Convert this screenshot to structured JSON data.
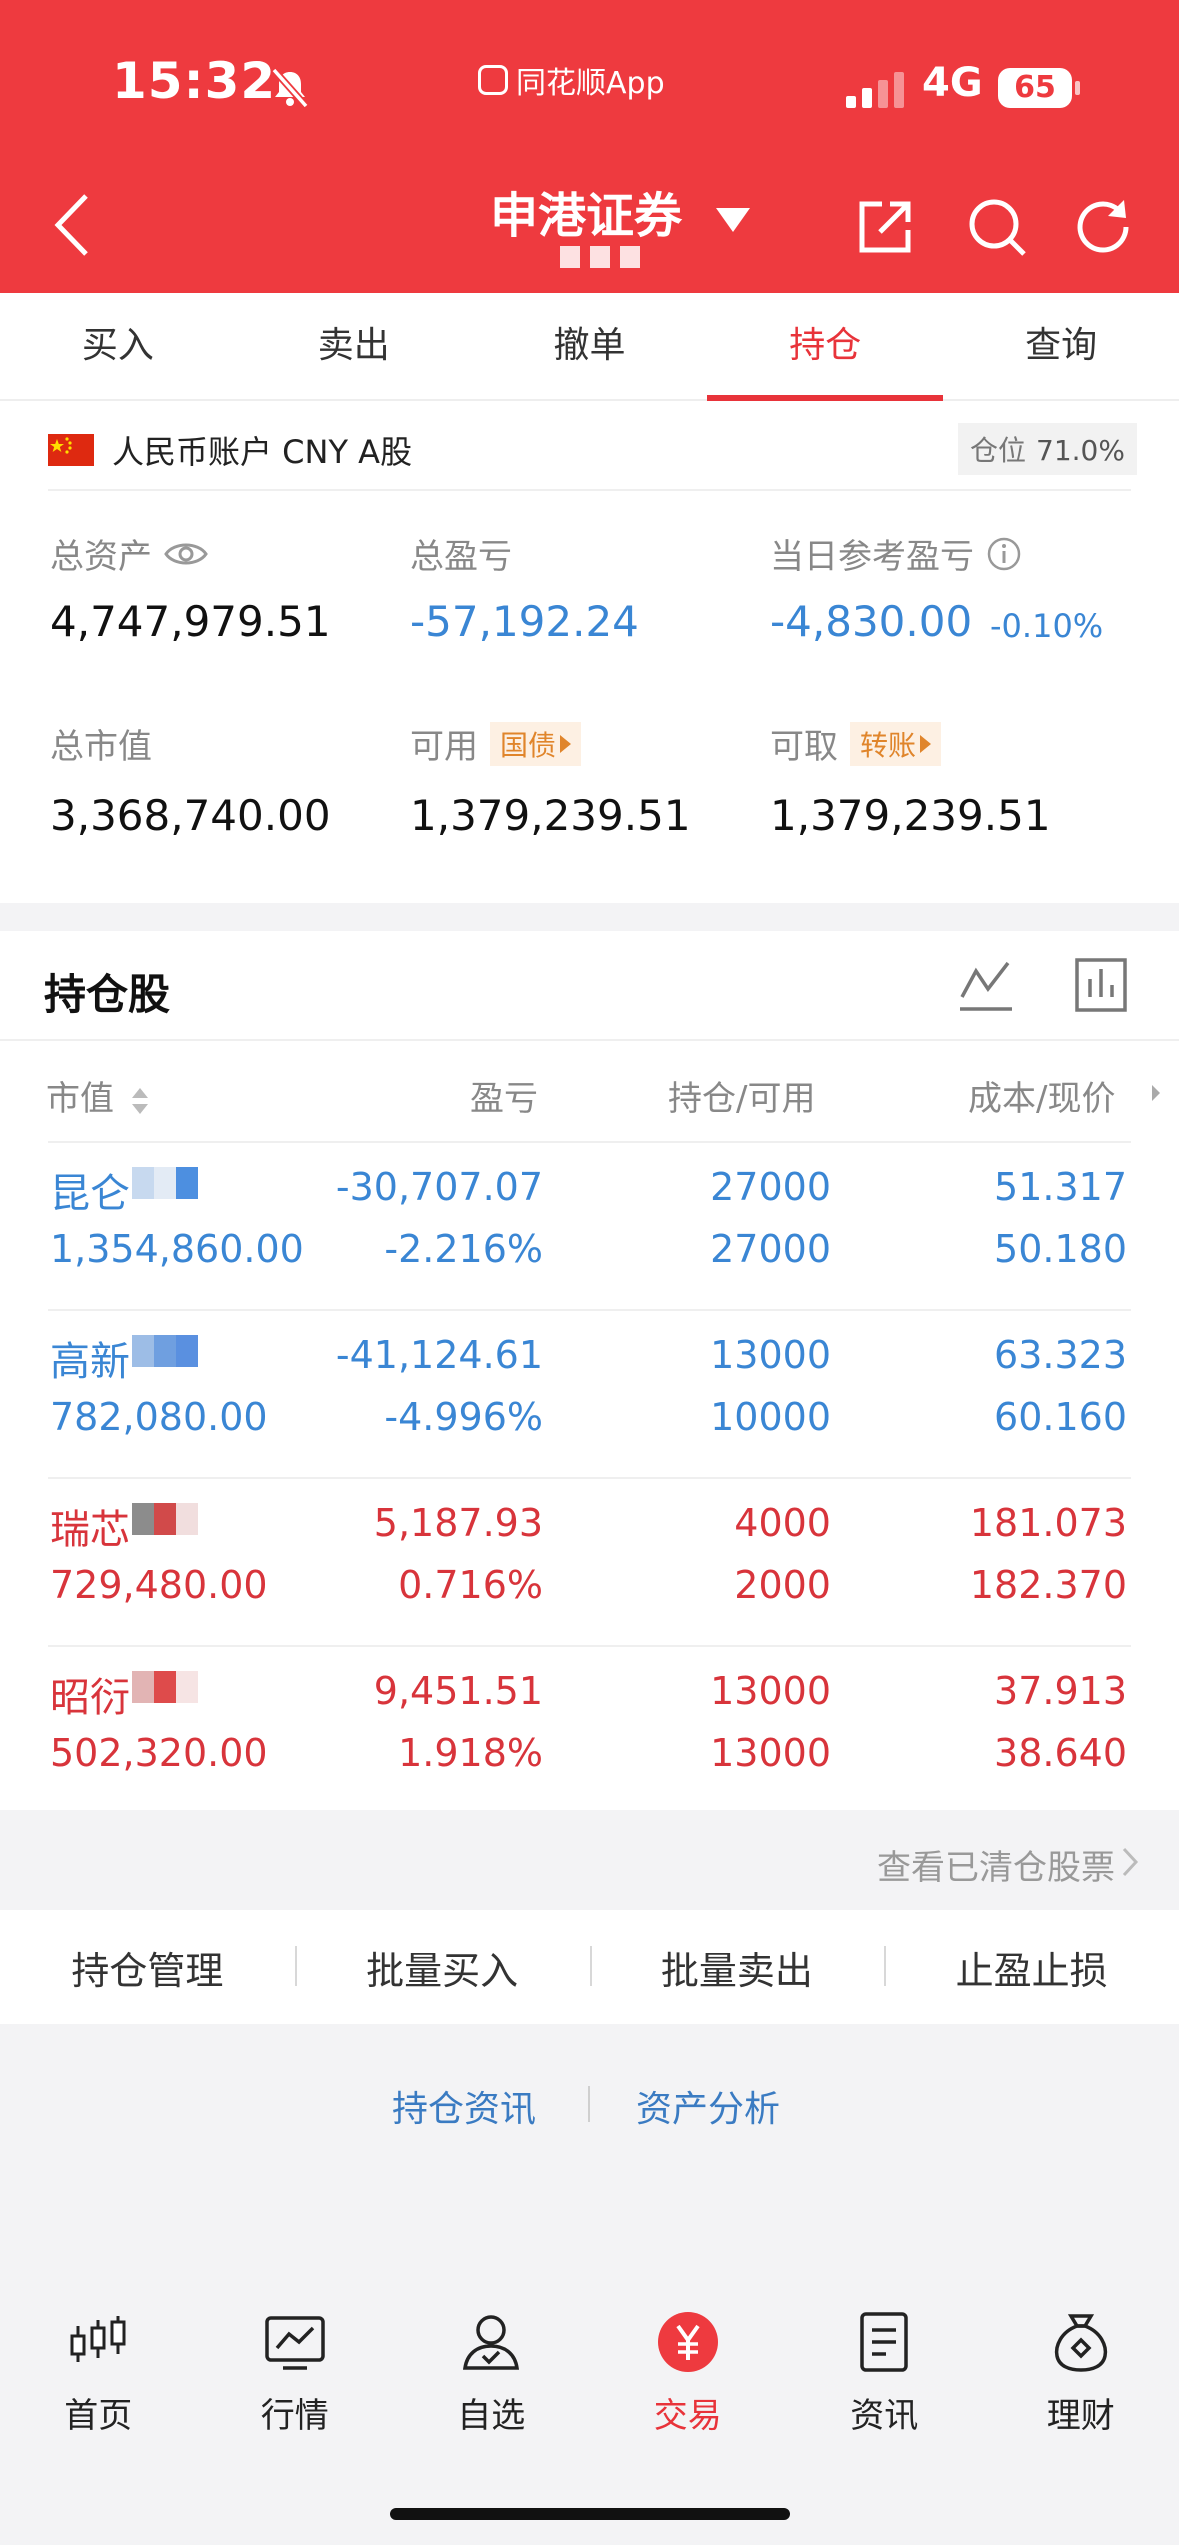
{
  "status_bar": {
    "time": "15:32",
    "app_tag": "同花顺App",
    "network": "4G",
    "battery": "65"
  },
  "header": {
    "title": "申港证券"
  },
  "tabs": [
    {
      "label": "买入"
    },
    {
      "label": "卖出"
    },
    {
      "label": "撤单"
    },
    {
      "label": "持仓",
      "active": true
    },
    {
      "label": "查询"
    }
  ],
  "account": {
    "currency_label": "人民币账户 CNY A股",
    "position_label": "仓位",
    "position_value": "71.0%",
    "total_assets_label": "总资产",
    "total_assets": "4,747,979.51",
    "total_pl_label": "总盈亏",
    "total_pl": "-57,192.24",
    "daily_pl_label": "当日参考盈亏",
    "daily_pl": "-4,830.00",
    "daily_pl_pct": "-0.10%",
    "market_value_label": "总市值",
    "market_value": "3,368,740.00",
    "available_label": "可用",
    "available_tag": "国债",
    "available": "1,379,239.51",
    "withdrawable_label": "可取",
    "withdrawable_tag": "转账",
    "withdrawable": "1,379,239.51"
  },
  "holdings": {
    "title": "持仓股",
    "columns": {
      "market_value": "市值",
      "pl": "盈亏",
      "position": "持仓/可用",
      "cost": "成本/现价"
    },
    "rows": [
      {
        "name": "昆仑",
        "color": "#3a86d4",
        "market_value": "1,354,860.00",
        "pl": "-30,707.07",
        "pl_pct": "-2.216%",
        "holding": "27000",
        "available": "27000",
        "cost": "51.317",
        "price": "50.180"
      },
      {
        "name": "高新",
        "color": "#3a86d4",
        "market_value": "782,080.00",
        "pl": "-41,124.61",
        "pl_pct": "-4.996%",
        "holding": "13000",
        "available": "10000",
        "cost": "63.323",
        "price": "60.160"
      },
      {
        "name": "瑞芯",
        "color": "#d8343b",
        "market_value": "729,480.00",
        "pl": "5,187.93",
        "pl_pct": "0.716%",
        "holding": "4000",
        "available": "2000",
        "cost": "181.073",
        "price": "182.370"
      },
      {
        "name": "昭衍",
        "color": "#d8343b",
        "market_value": "502,320.00",
        "pl": "9,451.51",
        "pl_pct": "1.918%",
        "holding": "13000",
        "available": "13000",
        "cost": "37.913",
        "price": "38.640"
      }
    ],
    "cleared_link": "查看已清仓股票"
  },
  "actions": [
    "持仓管理",
    "批量买入",
    "批量卖出",
    "止盈止损"
  ],
  "links": {
    "news": "持仓资讯",
    "analysis": "资产分析"
  },
  "bottom_nav": [
    {
      "label": "首页",
      "icon": "candlestick-icon"
    },
    {
      "label": "行情",
      "icon": "chart-icon"
    },
    {
      "label": "自选",
      "icon": "user-icon"
    },
    {
      "label": "交易",
      "icon": "yuan-icon",
      "active": true
    },
    {
      "label": "资讯",
      "icon": "document-icon"
    },
    {
      "label": "理财",
      "icon": "money-bag-icon"
    }
  ],
  "colors": {
    "brand_red": "#ee3a3f",
    "loss_blue": "#3a86d4",
    "gain_red": "#d8343b"
  }
}
